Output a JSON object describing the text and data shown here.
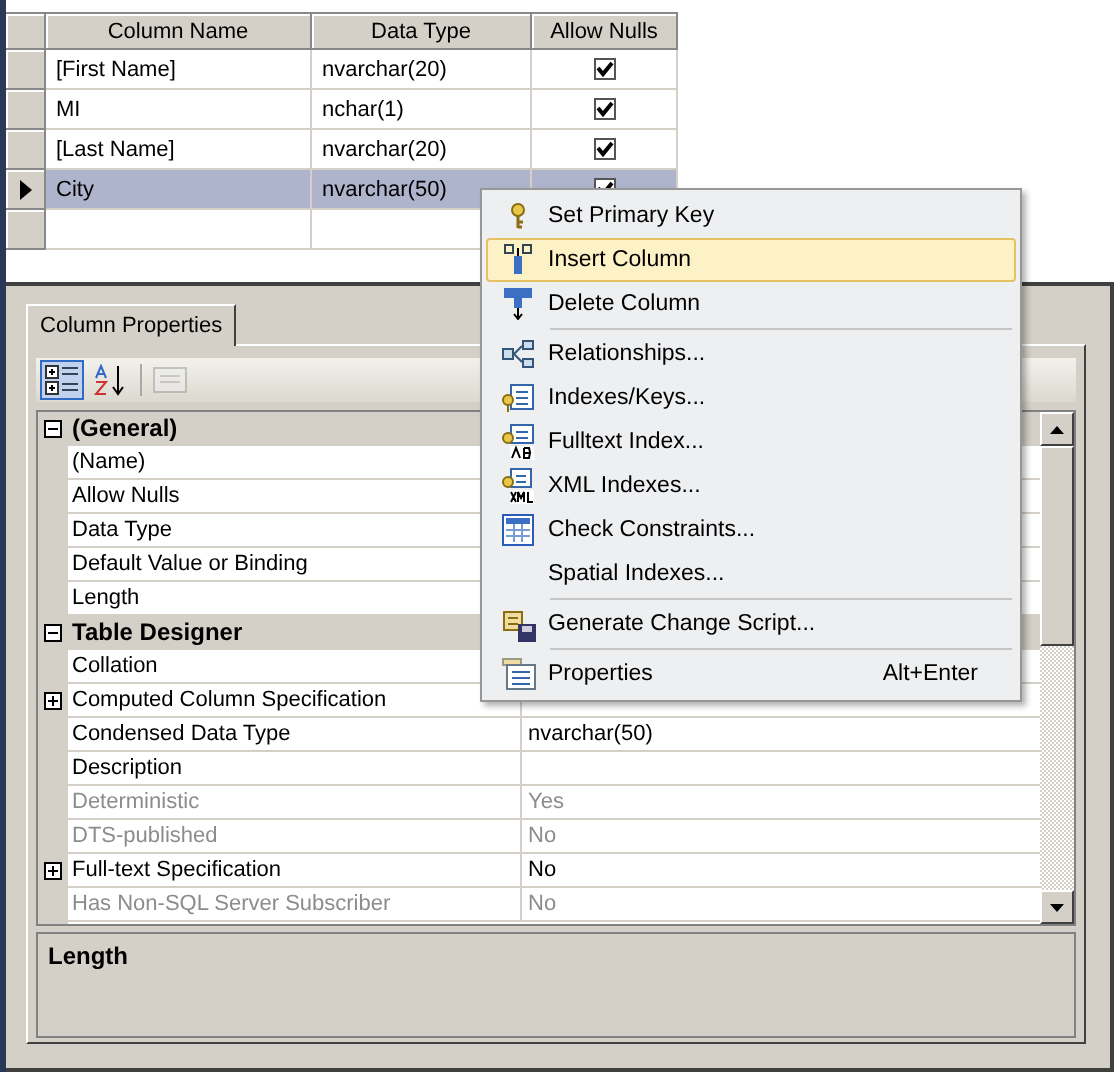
{
  "table": {
    "columns": [
      "Column Name",
      "Data Type",
      "Allow Nulls"
    ],
    "rows": [
      {
        "name": "[First Name]",
        "type": "nvarchar(20)",
        "allow_nulls": true,
        "selected": false
      },
      {
        "name": "MI",
        "type": "nchar(1)",
        "allow_nulls": true,
        "selected": false
      },
      {
        "name": "[Last Name]",
        "type": "nvarchar(20)",
        "allow_nulls": true,
        "selected": false
      },
      {
        "name": "City",
        "type": "nvarchar(50)",
        "allow_nulls": true,
        "selected": true
      }
    ]
  },
  "properties_panel": {
    "tab": {
      "label": "Column Properties",
      "selected": true
    },
    "toolbar": [
      {
        "kind": "categorized",
        "selected": true,
        "disabled": false
      },
      {
        "kind": "alphabetical",
        "selected": false,
        "disabled": false
      },
      {
        "kind": "property_pages",
        "selected": false,
        "disabled": true
      }
    ],
    "categories": [
      {
        "name": "(General)",
        "expanded": true,
        "children": [
          {
            "name": "(Name)",
            "disabled": false
          },
          {
            "name": "Allow Nulls",
            "disabled": false
          },
          {
            "name": "Data Type",
            "disabled": false
          },
          {
            "name": "Default Value or Binding",
            "disabled": false
          },
          {
            "name": "Length",
            "disabled": false
          }
        ]
      },
      {
        "name": "Table Designer",
        "expanded": true,
        "children": [
          {
            "name": "Collation",
            "disabled": false
          },
          {
            "name": "Computed Column Specification",
            "disabled": false,
            "expanded": false
          },
          {
            "name": "Condensed Data Type",
            "value": "nvarchar(50)",
            "disabled": false
          },
          {
            "name": "Description",
            "disabled": false
          },
          {
            "name": "Deterministic",
            "value": "Yes",
            "disabled": true
          },
          {
            "name": "DTS-published",
            "value": "No",
            "disabled": true
          },
          {
            "name": "Full-text Specification",
            "value": "No",
            "disabled": false,
            "expanded": false
          },
          {
            "name": "Has Non-SQL Server Subscriber",
            "value": "No",
            "disabled": true
          }
        ]
      }
    ],
    "description": {
      "title": "Length"
    }
  },
  "context_menu": [
    {
      "kind": "key",
      "label": "Set Primary Key",
      "highlighted": false
    },
    {
      "kind": "insert",
      "label": "Insert Column",
      "highlighted": true
    },
    {
      "kind": "delete",
      "label": "Delete Column",
      "highlighted": false
    },
    {
      "kind": "separator"
    },
    {
      "kind": "relationships",
      "label": "Relationships...",
      "highlighted": false
    },
    {
      "kind": "indexes",
      "label": "Indexes/Keys...",
      "highlighted": false
    },
    {
      "kind": "fulltext",
      "label": "Fulltext Index...",
      "highlighted": false
    },
    {
      "kind": "xml",
      "label": "XML Indexes...",
      "highlighted": false
    },
    {
      "kind": "constraints",
      "label": "Check Constraints...",
      "highlighted": false
    },
    {
      "kind": "plain",
      "label": "Spatial Indexes...",
      "highlighted": false
    },
    {
      "kind": "separator"
    },
    {
      "kind": "script",
      "label": "Generate Change Script...",
      "highlighted": false
    },
    {
      "kind": "separator"
    },
    {
      "kind": "properties",
      "label": "Properties",
      "shortcut": "Alt+Enter",
      "highlighted": false
    }
  ]
}
